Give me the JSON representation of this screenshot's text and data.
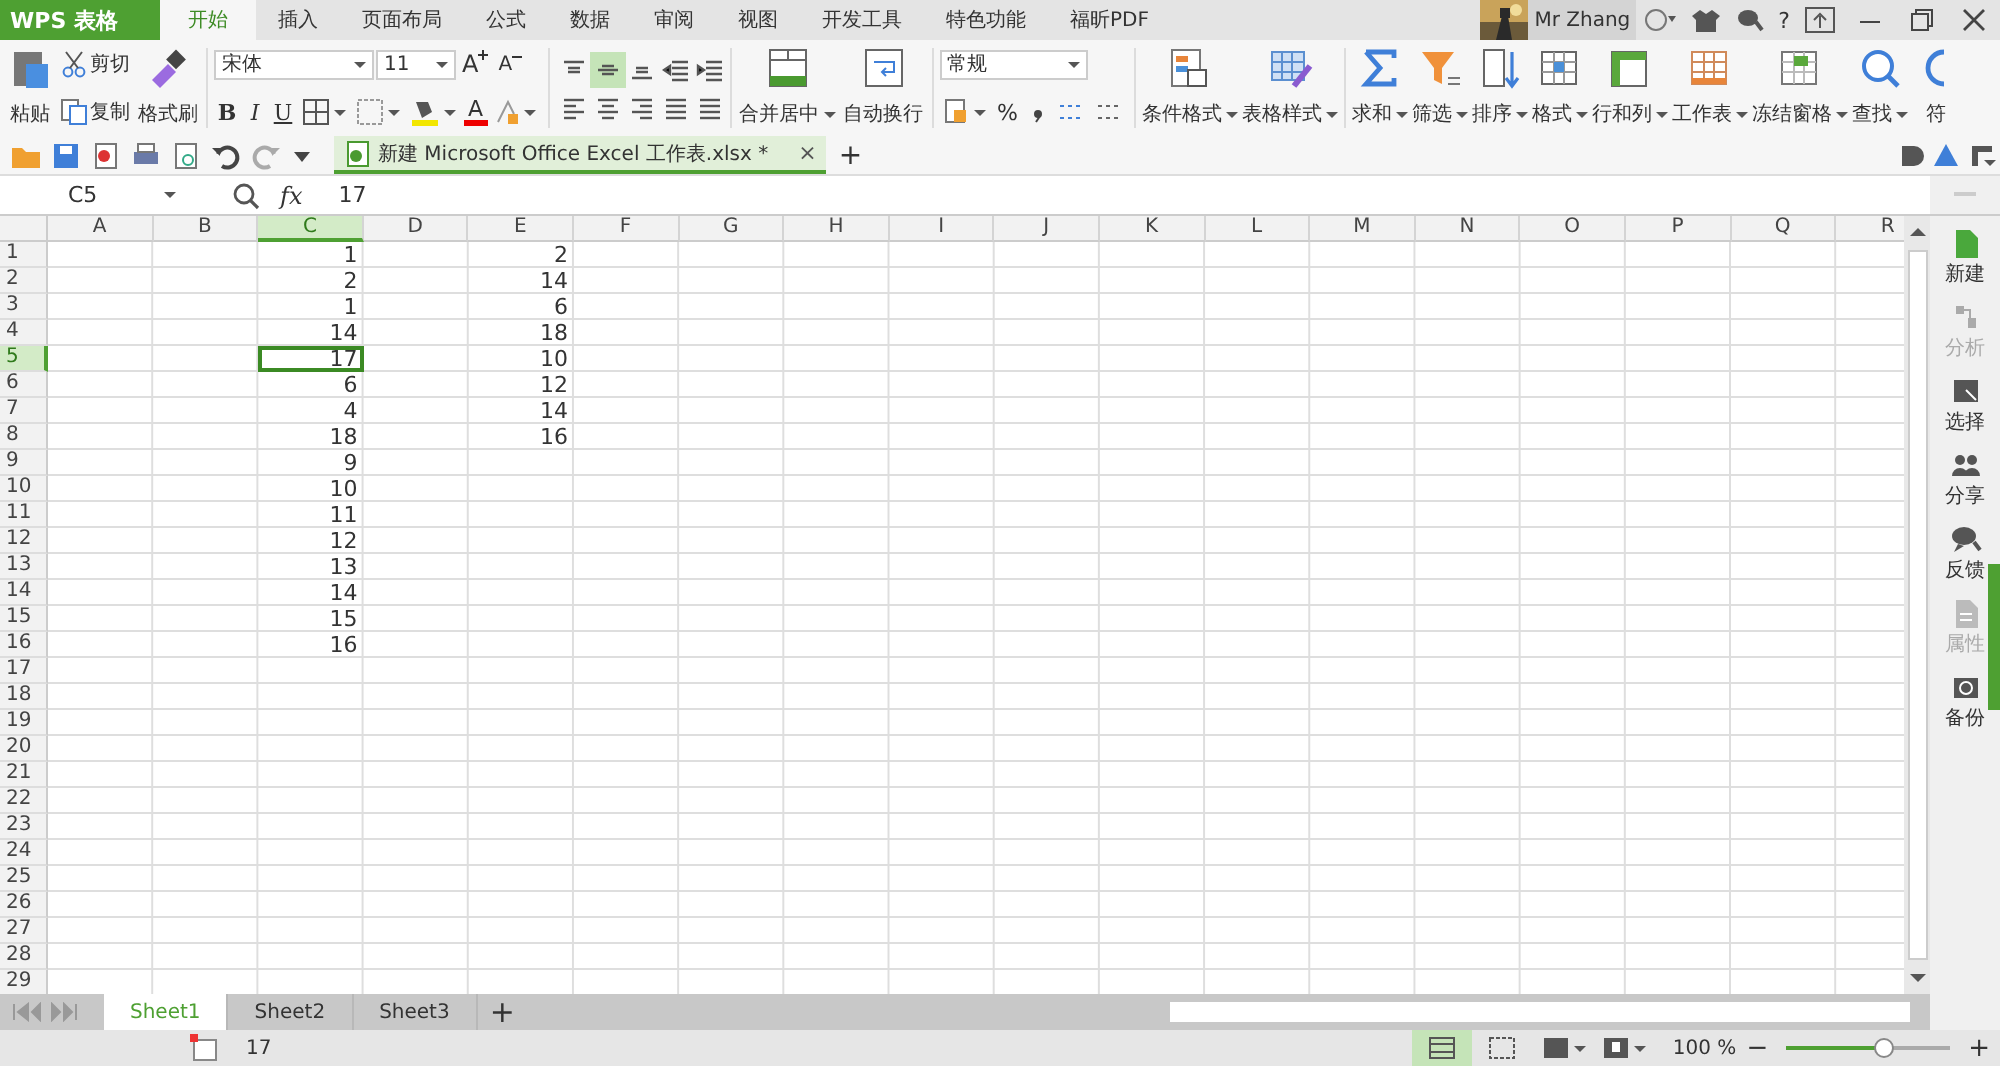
{
  "app_button": {
    "label": "WPS 表格"
  },
  "menu_tabs": [
    {
      "label": "开始",
      "selected": true
    },
    {
      "label": "插入",
      "selected": false
    },
    {
      "label": "页面布局",
      "selected": false
    },
    {
      "label": "公式",
      "selected": false
    },
    {
      "label": "数据",
      "selected": false
    },
    {
      "label": "审阅",
      "selected": false
    },
    {
      "label": "视图",
      "selected": false
    },
    {
      "label": "开发工具",
      "selected": false
    },
    {
      "label": "特色功能",
      "selected": false
    },
    {
      "label": "福昕PDF",
      "selected": false
    }
  ],
  "user": {
    "name": "Mr Zhang",
    "help": "?"
  },
  "ribbon": {
    "clipboard": {
      "paste": "粘贴",
      "cut": "剪切",
      "copy": "复制",
      "format_painter": "格式刷"
    },
    "font": {
      "font_name": "宋体",
      "font_size": "11",
      "grow": "A",
      "shrink": "A",
      "styles": [
        "B",
        "I",
        "U"
      ],
      "font_color": "A"
    },
    "alignment": {
      "merge": "合并居中",
      "wrap": "自动换行"
    },
    "number": {
      "format": "常规",
      "percent": "%"
    },
    "large_buttons": [
      {
        "label": "条件格式"
      },
      {
        "label": "表格样式"
      },
      {
        "label": "求和"
      },
      {
        "label": "筛选"
      },
      {
        "label": "排序"
      },
      {
        "label": "格式"
      },
      {
        "label": "行和列"
      },
      {
        "label": "工作表"
      },
      {
        "label": "冻结窗格"
      },
      {
        "label": "查找"
      },
      {
        "label": "符"
      }
    ]
  },
  "document_tab": {
    "title": "新建 Microsoft Office Excel 工作表.xlsx *",
    "close": "×",
    "new_tab": "+"
  },
  "formula_bar": {
    "name_box": "C5",
    "fx": "fx",
    "formula": "17"
  },
  "sheet": {
    "columns": [
      {
        "label": "A",
        "selected": false
      },
      {
        "label": "B",
        "selected": false
      },
      {
        "label": "C",
        "selected": true,
        "values": [
          "1",
          "2",
          "1",
          "14",
          "17",
          "6",
          "4",
          "18",
          "9",
          "10",
          "11",
          "12",
          "13",
          "14",
          "15",
          "16"
        ]
      },
      {
        "label": "D",
        "selected": false
      },
      {
        "label": "E",
        "selected": false,
        "values": [
          "2",
          "14",
          "6",
          "18",
          "10",
          "12",
          "14",
          "16"
        ]
      },
      {
        "label": "F",
        "selected": false
      },
      {
        "label": "G",
        "selected": false
      },
      {
        "label": "H",
        "selected": false
      },
      {
        "label": "I",
        "selected": false
      },
      {
        "label": "J",
        "selected": false
      },
      {
        "label": "K",
        "selected": false
      },
      {
        "label": "L",
        "selected": false
      },
      {
        "label": "M",
        "selected": false
      },
      {
        "label": "N",
        "selected": false
      },
      {
        "label": "O",
        "selected": false
      },
      {
        "label": "P",
        "selected": false
      },
      {
        "label": "Q",
        "selected": false
      },
      {
        "label": "R",
        "selected": false
      }
    ],
    "rows": [
      {
        "label": "1",
        "selected": false
      },
      {
        "label": "2",
        "selected": false
      },
      {
        "label": "3",
        "selected": false
      },
      {
        "label": "4",
        "selected": false
      },
      {
        "label": "5",
        "selected": true
      },
      {
        "label": "6",
        "selected": false
      },
      {
        "label": "7",
        "selected": false
      },
      {
        "label": "8",
        "selected": false
      },
      {
        "label": "9",
        "selected": false
      },
      {
        "label": "10",
        "selected": false
      },
      {
        "label": "11",
        "selected": false
      },
      {
        "label": "12",
        "selected": false
      },
      {
        "label": "13",
        "selected": false
      },
      {
        "label": "14",
        "selected": false
      },
      {
        "label": "15",
        "selected": false
      },
      {
        "label": "16",
        "selected": false
      },
      {
        "label": "17",
        "selected": false
      },
      {
        "label": "18",
        "selected": false
      },
      {
        "label": "19",
        "selected": false
      },
      {
        "label": "20",
        "selected": false
      },
      {
        "label": "21",
        "selected": false
      },
      {
        "label": "22",
        "selected": false
      },
      {
        "label": "23",
        "selected": false
      },
      {
        "label": "24",
        "selected": false
      },
      {
        "label": "25",
        "selected": false
      },
      {
        "label": "26",
        "selected": false
      },
      {
        "label": "27",
        "selected": false
      },
      {
        "label": "28",
        "selected": false
      },
      {
        "label": "29",
        "selected": false
      }
    ]
  },
  "side_panel": [
    {
      "label": "新建",
      "disabled": false
    },
    {
      "label": "分析",
      "disabled": true
    },
    {
      "label": "选择",
      "disabled": false
    },
    {
      "label": "分享",
      "disabled": false
    },
    {
      "label": "反馈",
      "disabled": false
    },
    {
      "label": "属性",
      "disabled": true
    },
    {
      "label": "备份",
      "disabled": false
    }
  ],
  "sheet_tabs": [
    {
      "label": "Sheet1",
      "selected": true
    },
    {
      "label": "Sheet2",
      "selected": false
    },
    {
      "label": "Sheet3",
      "selected": false
    }
  ],
  "add_sheet": "+",
  "status_bar": {
    "value": "17",
    "zoom": "100 %",
    "zoom_out": "−",
    "zoom_in": "+",
    "zoom_level": {
      "level": 0.6
    }
  }
}
